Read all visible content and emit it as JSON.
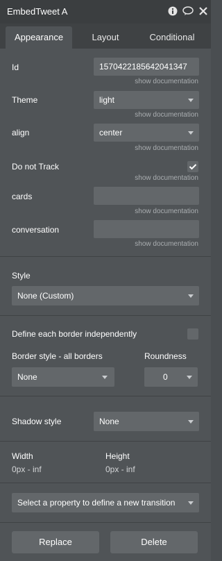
{
  "header": {
    "title": "EmbedTweet A",
    "icons": [
      "info-icon",
      "comment-icon",
      "close-icon"
    ]
  },
  "tabs": [
    {
      "label": "Appearance",
      "active": true
    },
    {
      "label": "Layout",
      "active": false
    },
    {
      "label": "Conditional",
      "active": false
    }
  ],
  "properties": {
    "show_doc": "show documentation",
    "id": {
      "label": "Id",
      "value": "1570422185642041347"
    },
    "theme": {
      "label": "Theme",
      "value": "light"
    },
    "align": {
      "label": "align",
      "value": "center"
    },
    "do_not_track": {
      "label": "Do not Track",
      "checked": true
    },
    "cards": {
      "label": "cards",
      "value": ""
    },
    "conversation": {
      "label": "conversation",
      "value": ""
    }
  },
  "style": {
    "label": "Style",
    "value": "None (Custom)"
  },
  "border": {
    "define_each_label": "Define each border independently",
    "style_label": "Border style - all borders",
    "style_value": "None",
    "roundness_label": "Roundness",
    "roundness_value": "0"
  },
  "shadow": {
    "label": "Shadow style",
    "value": "None"
  },
  "size": {
    "width_label": "Width",
    "width_value": "0px - inf",
    "height_label": "Height",
    "height_value": "0px - inf"
  },
  "transition": {
    "placeholder": "Select a property to define a new transition"
  },
  "actions": {
    "replace_label": "Replace",
    "delete_label": "Delete"
  },
  "colors": {
    "panel_bg": "#505457",
    "titlebar_bg": "#3b3e40",
    "field_bg": "#63676a"
  }
}
